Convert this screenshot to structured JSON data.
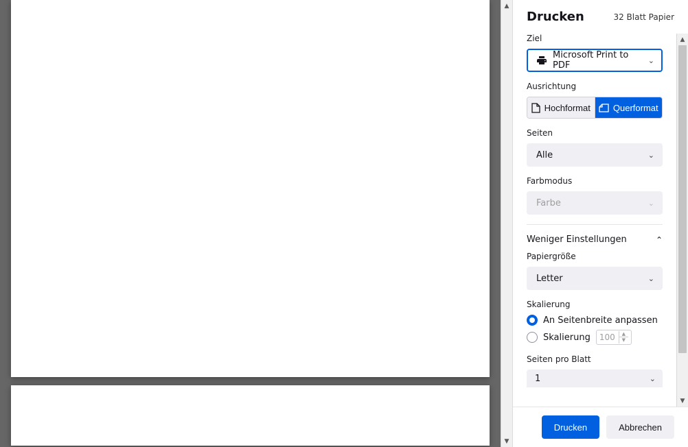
{
  "header": {
    "title": "Drucken",
    "sheet_count": "32 Blatt Papier"
  },
  "destination": {
    "label": "Ziel",
    "value": "Microsoft Print to PDF"
  },
  "orientation": {
    "label": "Ausrichtung",
    "portrait": "Hochformat",
    "landscape": "Querformat"
  },
  "pages": {
    "label": "Seiten",
    "value": "Alle"
  },
  "color": {
    "label": "Farbmodus",
    "value": "Farbe"
  },
  "settings_toggle": "Weniger Einstellungen",
  "paper_size": {
    "label": "Papiergröße",
    "value": "Letter"
  },
  "scaling": {
    "label": "Skalierung",
    "fit_label": "An Seitenbreite anpassen",
    "scale_label": "Skalierung",
    "scale_value": "100"
  },
  "per_sheet": {
    "label": "Seiten pro Blatt",
    "value": "1"
  },
  "footer": {
    "print": "Drucken",
    "cancel": "Abbrechen"
  }
}
